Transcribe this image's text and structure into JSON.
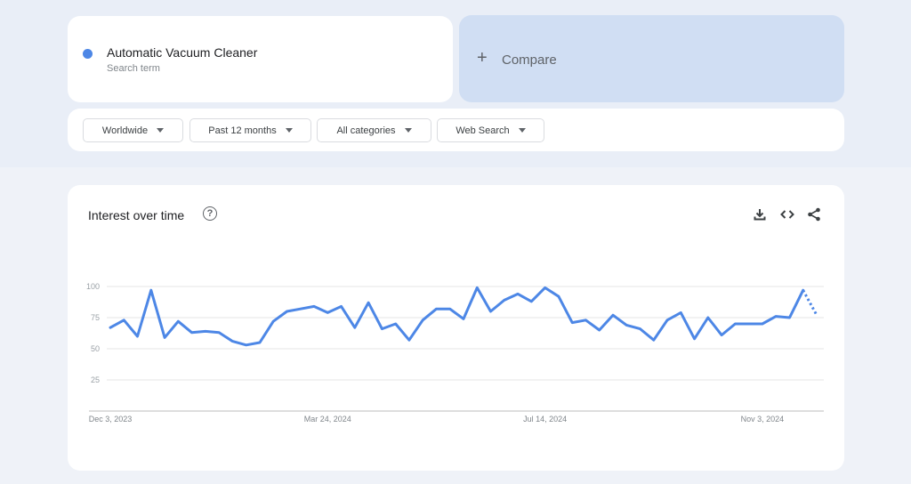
{
  "search_term": {
    "name": "Automatic Vacuum Cleaner",
    "subtitle": "Search term",
    "color": "#4d87e6"
  },
  "compare": {
    "icon": "plus-icon",
    "plus": "+",
    "label": "Compare"
  },
  "filters": [
    {
      "label": "Worldwide"
    },
    {
      "label": "Past 12 months"
    },
    {
      "label": "All categories"
    },
    {
      "label": "Web Search"
    }
  ],
  "panel": {
    "title": "Interest over time",
    "help_glyph": "?",
    "tools": [
      "download-icon",
      "embed-code-icon",
      "share-icon"
    ]
  },
  "chart_data": {
    "type": "line",
    "title": "Interest over time",
    "xlabel": "",
    "ylabel": "",
    "ylim": [
      0,
      100
    ],
    "yticks": [
      25,
      50,
      75,
      100
    ],
    "grid": true,
    "legend": "none",
    "x_tick_labels": [
      {
        "label": "Dec 3, 2023",
        "index": 0
      },
      {
        "label": "Mar 24, 2024",
        "index": 16
      },
      {
        "label": "Jul 14, 2024",
        "index": 32
      },
      {
        "label": "Nov 3, 2024",
        "index": 48
      }
    ],
    "series": [
      {
        "name": "Automatic Vacuum Cleaner",
        "color": "#4d87e6",
        "values": [
          67,
          73,
          60,
          97,
          59,
          72,
          63,
          64,
          63,
          56,
          53,
          55,
          72,
          80,
          82,
          84,
          79,
          84,
          67,
          87,
          66,
          70,
          57,
          73,
          82,
          82,
          74,
          99,
          80,
          89,
          94,
          88,
          99,
          92,
          71,
          73,
          65,
          77,
          69,
          66,
          57,
          73,
          79,
          58,
          75,
          61,
          70,
          70,
          70,
          76,
          75,
          97,
          77
        ],
        "partial_last_point": true
      }
    ]
  }
}
